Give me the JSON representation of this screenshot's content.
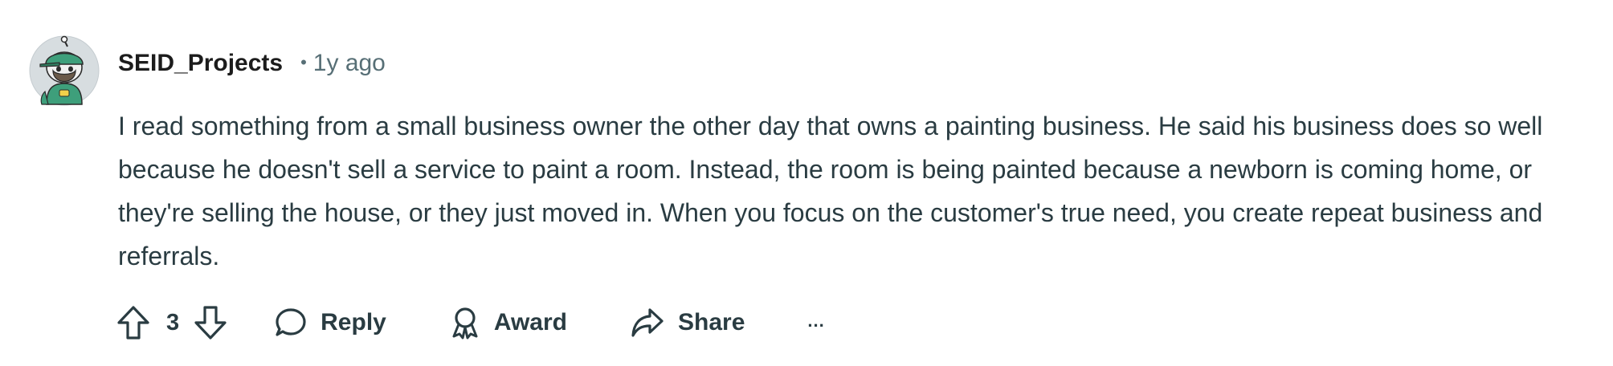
{
  "comment": {
    "author": "SEID_Projects",
    "separator": "•",
    "timestamp": "1y ago",
    "body": "I read something from a small business owner the other day that owns a painting business. He said his business does so well because he doesn't sell a service to paint a room. Instead, the room is being painted because a newborn is coming home, or they're selling the house, or they just moved in. When you focus on the customer's true need, you create repeat business and referrals."
  },
  "actions": {
    "score": "3",
    "reply_label": "Reply",
    "award_label": "Award",
    "share_label": "Share",
    "more_label": "..."
  },
  "icons": {
    "avatar": "snoo-avatar-green-cap",
    "upvote": "upvote-arrow-icon",
    "downvote": "downvote-arrow-icon",
    "reply": "speech-bubble-icon",
    "award": "award-ribbon-icon",
    "share": "share-arrow-icon",
    "more": "ellipsis-icon"
  },
  "colors": {
    "text_primary": "#1c1c1c",
    "text_secondary": "#576f76",
    "text_body": "#2a3c42",
    "avatar_green": "#3e9f7b",
    "avatar_bg": "#d7dde0"
  }
}
